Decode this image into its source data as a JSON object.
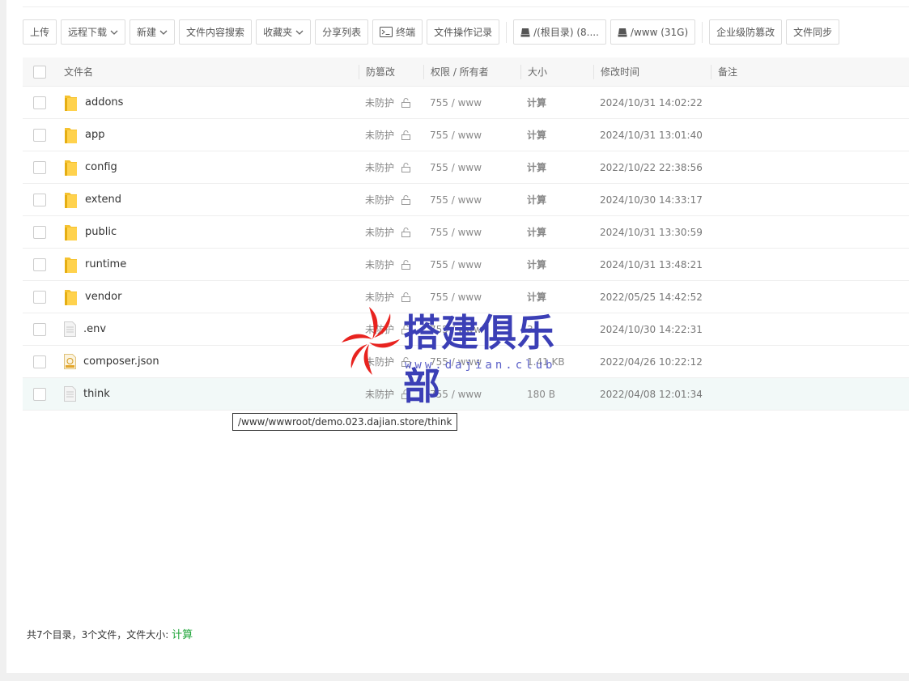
{
  "toolbar": {
    "upload": "上传",
    "remote_download": "远程下载",
    "new": "新建",
    "content_search": "文件内容搜索",
    "favorites": "收藏夹",
    "share_list": "分享列表",
    "terminal": "终端",
    "operation_log": "文件操作记录",
    "disk_root": "/(根目录) (8....",
    "disk_www": "/www (31G)",
    "enterprise_protect": "企业级防篡改",
    "file_sync": "文件同步"
  },
  "columns": {
    "name": "文件名",
    "protect": "防篡改",
    "perm": "权限 / 所有者",
    "size": "大小",
    "mtime": "修改时间",
    "note": "备注"
  },
  "rows": [
    {
      "name": "addons",
      "type": "folder",
      "protect": "未防护",
      "perm": "755 / www",
      "size": "计算",
      "mtime": "2024/10/31 14:02:22"
    },
    {
      "name": "app",
      "type": "folder",
      "protect": "未防护",
      "perm": "755 / www",
      "size": "计算",
      "mtime": "2024/10/31 13:01:40"
    },
    {
      "name": "config",
      "type": "folder",
      "protect": "未防护",
      "perm": "755 / www",
      "size": "计算",
      "mtime": "2022/10/22 22:38:56"
    },
    {
      "name": "extend",
      "type": "folder",
      "protect": "未防护",
      "perm": "755 / www",
      "size": "计算",
      "mtime": "2024/10/30 14:33:17"
    },
    {
      "name": "public",
      "type": "folder",
      "protect": "未防护",
      "perm": "755 / www",
      "size": "计算",
      "mtime": "2024/10/31 13:30:59"
    },
    {
      "name": "runtime",
      "type": "folder",
      "protect": "未防护",
      "perm": "755 / www",
      "size": "计算",
      "mtime": "2024/10/31 13:48:21"
    },
    {
      "name": "vendor",
      "type": "folder",
      "protect": "未防护",
      "perm": "755 / www",
      "size": "计算",
      "mtime": "2022/05/25 14:42:52"
    },
    {
      "name": ".env",
      "type": "file",
      "protect": "未防护",
      "perm": "755 / www",
      "size": "34",
      "mtime": "2024/10/30 14:22:31"
    },
    {
      "name": "composer.json",
      "type": "json",
      "protect": "未防护",
      "perm": "755 / www",
      "size": "1.41 KB",
      "mtime": "2022/04/26 10:22:12"
    },
    {
      "name": "think",
      "type": "file",
      "protect": "未防护",
      "perm": "755 / www",
      "size": "180 B",
      "mtime": "2022/04/08 12:01:34"
    }
  ],
  "tooltip": "/www/wwwroot/demo.023.dajian.store/think",
  "footer": {
    "summary": "共7个目录，3个文件，文件大小: ",
    "calc": "计算"
  },
  "watermark": {
    "title": "搭建俱乐部",
    "url": "www.dajian.club"
  },
  "colors": {
    "accent": "#20a53a",
    "hover_row": "#f2f9f8",
    "watermark": "#3b3fb6",
    "watermark_logo": "#e8231f"
  }
}
